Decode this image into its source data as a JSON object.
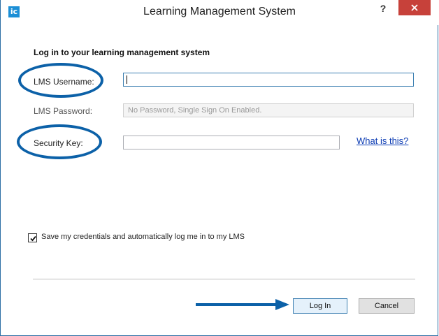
{
  "window": {
    "title": "Learning Management System",
    "help_label": "?",
    "app_icon_text": "ic"
  },
  "form": {
    "heading": "Log in to your learning management system",
    "username_label": "LMS Username:",
    "username_value": "",
    "password_label": "LMS Password:",
    "password_placeholder": "No Password, Single Sign On Enabled.",
    "security_key_label": "Security Key:",
    "security_key_value": "",
    "help_link": "What is this?",
    "save_credentials_label": "Save my credentials and automatically log me in to my LMS",
    "save_credentials_checked": true
  },
  "buttons": {
    "login_label": "Log In",
    "cancel_label": "Cancel"
  },
  "colors": {
    "accent": "#0c61a8",
    "close": "#c7413a",
    "link": "#0b3bb3"
  },
  "icons": [
    "app-icon",
    "help-icon",
    "close-icon",
    "check-icon",
    "arrow-icon"
  ]
}
